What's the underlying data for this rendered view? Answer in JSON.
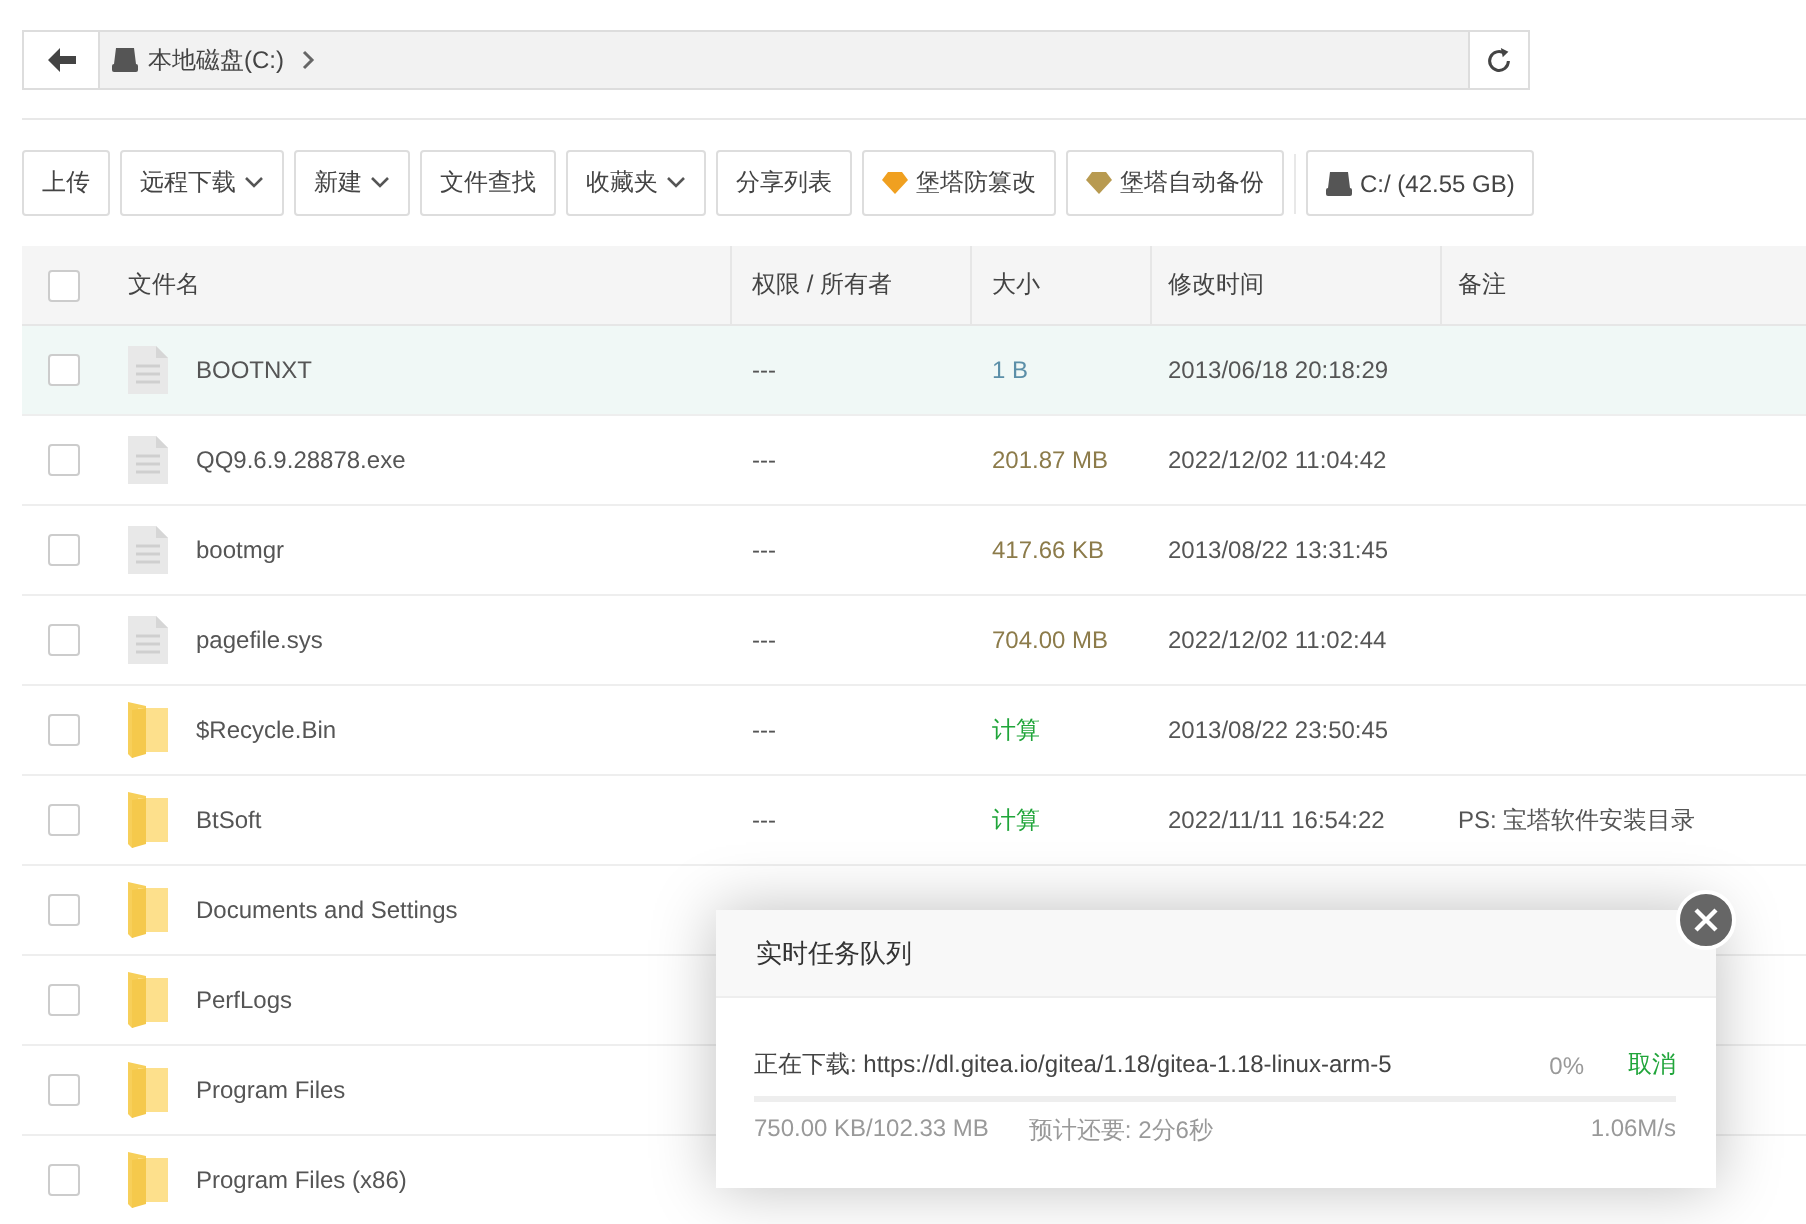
{
  "path_bar": {
    "crumbs": [
      "本地磁盘(C:)"
    ]
  },
  "toolbar": {
    "buttons": [
      {
        "label": "上传",
        "kind": "plain"
      },
      {
        "label": "远程下载",
        "kind": "dropdown"
      },
      {
        "label": "新建",
        "kind": "dropdown"
      },
      {
        "label": "文件查找",
        "kind": "plain"
      },
      {
        "label": "收藏夹",
        "kind": "dropdown"
      },
      {
        "label": "分享列表",
        "kind": "plain"
      },
      {
        "label": "堡塔防篡改",
        "kind": "gem",
        "color": "#f0a020"
      },
      {
        "label": "堡塔自动备份",
        "kind": "gem",
        "color": "#b89a50"
      },
      {
        "label": "C:/ (42.55 GB)",
        "kind": "disk"
      }
    ]
  },
  "table": {
    "select_all_checked": false,
    "columns": [
      "文件名",
      "权限 / 所有者",
      "大小",
      "修改时间",
      "备注"
    ],
    "rows": [
      {
        "kind": "file",
        "name": "BOOTNXT",
        "owner": "---",
        "size": "1 B",
        "color": "#5b8fa8",
        "modified": "2013/06/18 20:18:29",
        "selected": true,
        "checked": false
      },
      {
        "kind": "file",
        "name": "QQ9.6.9.28878.exe",
        "owner": "---",
        "size": "201.87 MB",
        "color": "#8c7b4a",
        "modified": "2022/12/02 11:04:42",
        "selected": false,
        "checked": false
      },
      {
        "kind": "file",
        "name": "bootmgr",
        "owner": "---",
        "size": "417.66 KB",
        "color": "#8c7b4a",
        "modified": "2013/08/22 13:31:45",
        "selected": false,
        "checked": false
      },
      {
        "kind": "file",
        "name": "pagefile.sys",
        "owner": "---",
        "size": "704.00 MB",
        "color": "#8c7b4a",
        "modified": "2022/12/02 11:02:44",
        "selected": false,
        "checked": false
      },
      {
        "kind": "folder",
        "name": "$Recycle.Bin",
        "owner": "---",
        "size": "计算",
        "color": "#20a53a",
        "modified": "2013/08/22 23:50:45",
        "selected": false,
        "checked": false
      },
      {
        "kind": "folder",
        "name": "BtSoft",
        "owner": "---",
        "size": "计算",
        "color": "#20a53a",
        "modified": "2022/11/11 16:54:22",
        "note": "PS: 宝塔软件安装目录",
        "selected": false,
        "checked": false
      },
      {
        "kind": "folder",
        "name": "Documents and Settings",
        "selected": false,
        "checked": false
      },
      {
        "kind": "folder",
        "name": "PerfLogs",
        "selected": false,
        "checked": false
      },
      {
        "kind": "folder",
        "name": "Program Files",
        "selected": false,
        "checked": false
      },
      {
        "kind": "folder",
        "name": "Program Files (x86)",
        "selected": false,
        "checked": false
      }
    ]
  },
  "task_dialog": {
    "title": "实时任务队列",
    "task": {
      "label": "正在下载: https://dl.gitea.io/gitea/1.18/gitea-1.18-linux-arm-5",
      "percent": "0%",
      "cancel": "取消",
      "level": 0,
      "progress": "750.00 KB/102.33 MB",
      "eta": "预计还要: 2分6秒",
      "speed": "1.06M/s"
    }
  }
}
